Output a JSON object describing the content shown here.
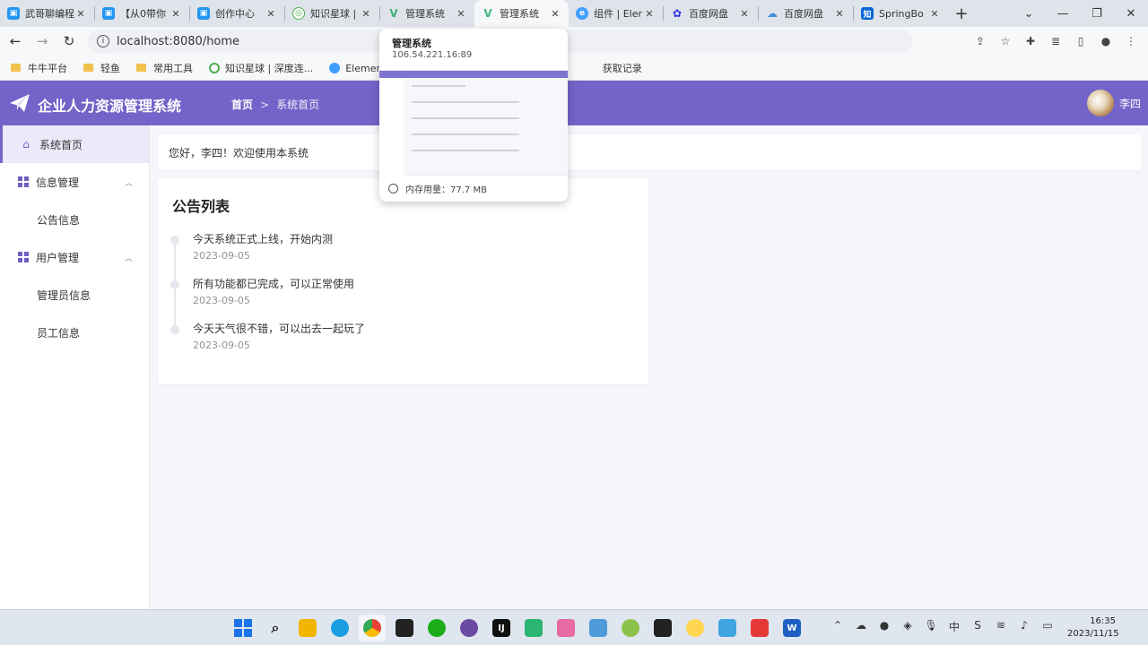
{
  "browser": {
    "tabs": [
      {
        "label": "武哥聊编程",
        "icon": "bilibili-icon",
        "color": "#2196f3",
        "glyph": "▣"
      },
      {
        "label": "【从0带你",
        "icon": "bilibili-icon",
        "color": "#2196f3",
        "glyph": "▣"
      },
      {
        "label": "创作中心",
        "icon": "bilibili-icon",
        "color": "#2196f3",
        "glyph": "▣"
      },
      {
        "label": "知识星球 |",
        "icon": "knowledge-planet-icon",
        "color": "#4caf50",
        "glyph": "◎"
      },
      {
        "label": "管理系统",
        "icon": "vue-icon",
        "color": "#3fb27f",
        "glyph": "V"
      },
      {
        "label": "管理系统",
        "icon": "vue-icon",
        "color": "#3fb27f",
        "glyph": "V",
        "active": true
      },
      {
        "label": "组件 | Eler",
        "icon": "element-icon",
        "color": "#409eff",
        "glyph": "e"
      },
      {
        "label": "百度网盘",
        "icon": "baidu-icon",
        "color": "#2932e1",
        "glyph": "✿"
      },
      {
        "label": "百度网盘",
        "icon": "baidu-netdisk-icon",
        "color": "#3a8ee6",
        "glyph": "☁"
      },
      {
        "label": "SpringBo",
        "icon": "zhihu-icon",
        "color": "#0a66d8",
        "glyph": "知"
      }
    ],
    "close_glyph": "✕",
    "new_tab_glyph": "+",
    "window_controls": [
      "⌄",
      "—",
      "❐",
      "✕"
    ],
    "url": "localhost:8080/home",
    "nav": {
      "back": "←",
      "forward": "→",
      "reload": "↻"
    },
    "bookmarks": [
      {
        "label": "牛牛平台",
        "type": "folder"
      },
      {
        "label": "轻鱼",
        "type": "folder"
      },
      {
        "label": "常用工具",
        "type": "folder"
      },
      {
        "label": "知识星球 | 深度连...",
        "type": "site",
        "color": "#4caf50"
      },
      {
        "label": "Element - 网站",
        "type": "site",
        "color": "#409eff"
      },
      {
        "label": "获取记录",
        "type": "site",
        "color": "#888888"
      }
    ]
  },
  "hovercard": {
    "title": "管理系统",
    "host": "106.54.221.16:89",
    "memory": "内存用量：77.7 MB"
  },
  "app": {
    "title": "企业人力资源管理系统",
    "breadcrumb": {
      "home": "首页",
      "separator": ">",
      "current": "系统首页"
    },
    "user": "李四",
    "accent": "#7264c8"
  },
  "sidebar": {
    "home": "系统首页",
    "groups": [
      {
        "label": "信息管理",
        "items": [
          "公告信息"
        ]
      },
      {
        "label": "用户管理",
        "items": [
          "管理员信息",
          "员工信息"
        ]
      }
    ]
  },
  "main": {
    "welcome": "您好，李四！欢迎使用本系统",
    "notice_title": "公告列表",
    "notices": [
      {
        "text": "今天系统正式上线，开始内测",
        "date": "2023-09-05"
      },
      {
        "text": "所有功能都已完成，可以正常使用",
        "date": "2023-09-05"
      },
      {
        "text": "今天天气很不错，可以出去一起玩了",
        "date": "2023-09-05"
      }
    ]
  },
  "taskbar": {
    "time": "16:35",
    "date": "2023/11/15"
  }
}
